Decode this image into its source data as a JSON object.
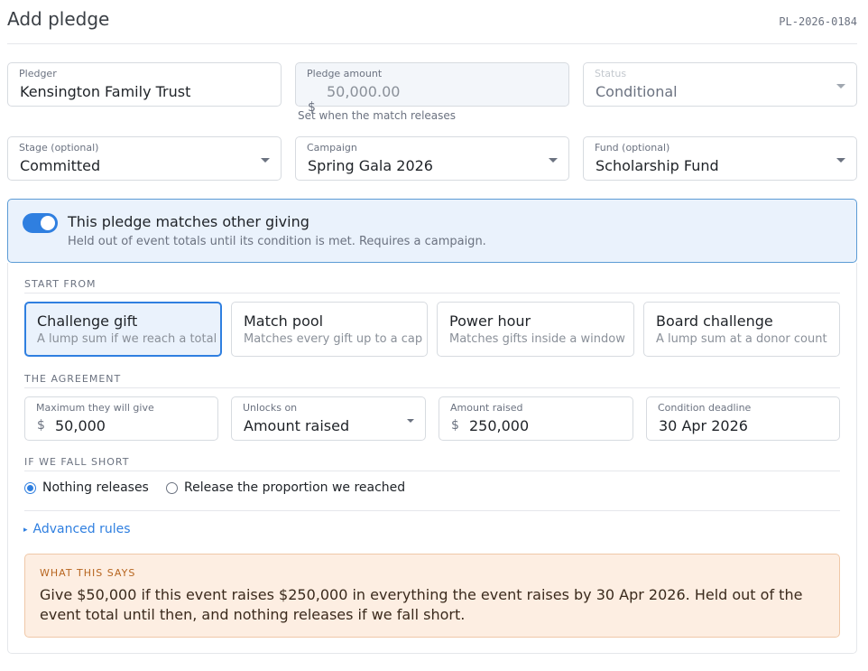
{
  "header": {
    "title": "Add pledge",
    "record_id": "PL-2026-0184"
  },
  "pledger": {
    "label": "Pledger",
    "value": "Kensington Family Trust"
  },
  "pledge_amount": {
    "label": "Pledge amount",
    "currency": "$",
    "value": "50,000.00",
    "hint": "Set when the match releases"
  },
  "status": {
    "label": "Status",
    "value": "Conditional"
  },
  "stage": {
    "label": "Stage (optional)",
    "value": "Committed"
  },
  "campaign": {
    "label": "Campaign",
    "value": "Spring Gala 2026"
  },
  "fund": {
    "label": "Fund (optional)",
    "value": "Scholarship Fund"
  },
  "match": {
    "enabled": true,
    "title": "This pledge matches other giving",
    "subtitle": "Held out of event totals until its condition is met. Requires a campaign."
  },
  "start_from": {
    "label": "START FROM",
    "options": [
      {
        "title": "Challenge gift",
        "subtitle": "A lump sum if we reach a total",
        "selected": true
      },
      {
        "title": "Match pool",
        "subtitle": "Matches every gift up to a cap",
        "selected": false
      },
      {
        "title": "Power hour",
        "subtitle": "Matches gifts inside a window",
        "selected": false
      },
      {
        "title": "Board challenge",
        "subtitle": "A lump sum at a donor count",
        "selected": false
      }
    ]
  },
  "agreement": {
    "label": "THE AGREEMENT",
    "max_give": {
      "label": "Maximum they will give",
      "currency": "$",
      "value": "50,000"
    },
    "unlocks_on": {
      "label": "Unlocks on",
      "value": "Amount raised"
    },
    "amount_raised": {
      "label": "Amount raised",
      "currency": "$",
      "value": "250,000"
    },
    "deadline": {
      "label": "Condition deadline",
      "value": "30 Apr 2026"
    }
  },
  "fall_short": {
    "label": "IF WE FALL SHORT",
    "options": [
      {
        "label": "Nothing releases",
        "checked": true
      },
      {
        "label": "Release the proportion we reached",
        "checked": false
      }
    ]
  },
  "advanced": {
    "label": "Advanced rules"
  },
  "summary": {
    "label": "WHAT THIS SAYS",
    "text": "Give $50,000 if this event raises $250,000 in everything the event raises by 30 Apr 2026. Held out of the event total until then, and nothing releases if we fall short."
  },
  "colors": {
    "accent": "#2f7fe0",
    "summary_bg": "#fdeee2",
    "summary_label": "#b7651f",
    "banner_bg": "#eaf2fc"
  }
}
